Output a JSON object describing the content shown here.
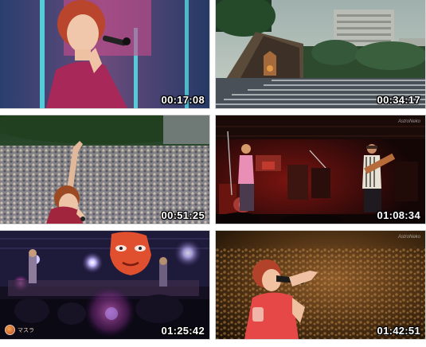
{
  "contact_sheet": {
    "thumbnails": [
      {
        "timestamp": "00:17:08",
        "scene": "Singer with short red hair holding microphone, pink stage lights"
      },
      {
        "timestamp": "00:34:17",
        "scene": "Outdoor amphitheater with large crowd, tall building behind trees"
      },
      {
        "timestamp": "00:51:25",
        "scene": "Singer raising arm toward large outdoor crowd"
      },
      {
        "timestamp": "01:08:34",
        "scene": "Band performing on dark stage with red lighting"
      },
      {
        "timestamp": "01:25:42",
        "scene": "Stage with giant face backdrop and purple spotlights"
      },
      {
        "timestamp": "01:42:51",
        "scene": "Singer in red shirt singing into microphone, warm crowd background"
      }
    ],
    "watermark_text": "AstroNeko",
    "logo_text": "マスラ"
  },
  "colors": {
    "background": "#ffffff",
    "timestamp_text": "#ffffff"
  }
}
